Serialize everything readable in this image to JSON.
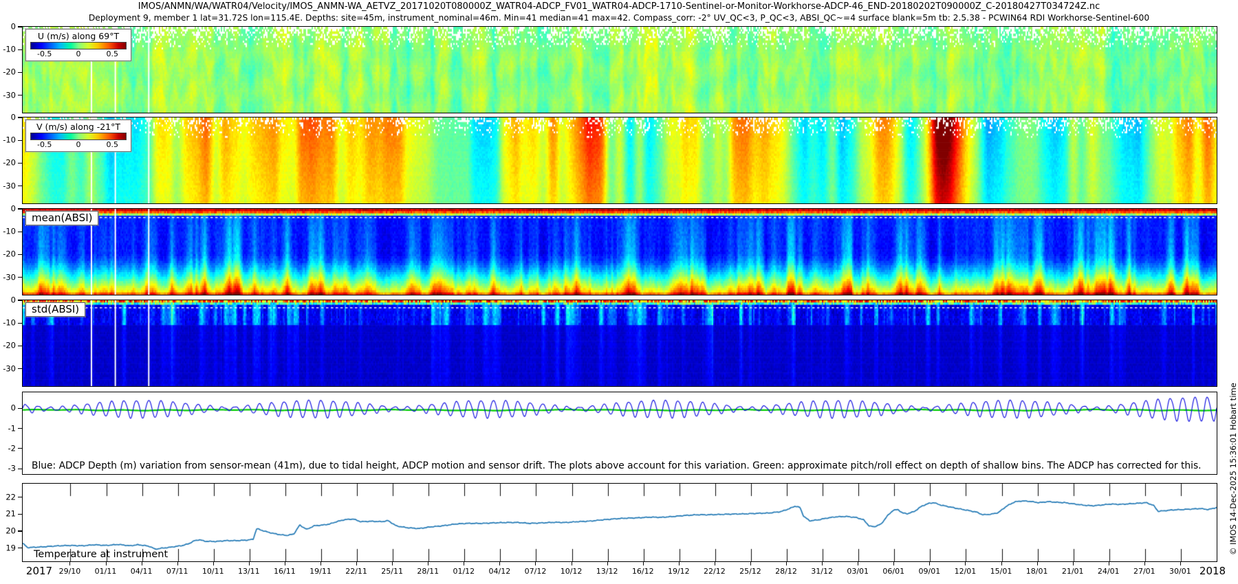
{
  "meta": {
    "title_line1": "IMOS/ANMN/WA/WATR04/Velocity/IMOS_ANMN-WA_AETVZ_20171020T080000Z_WATR04-ADCP_FV01_WATR04-ADCP-1710-Sentinel-or-Monitor-Workhorse-ADCP-46_END-20180202T090000Z_C-20180427T034724Z.nc",
    "title_line2": "Deployment 9, member 1 lat=31.72S lon=115.4E. Depths: site=45m, instrument_nominal=46m. Min=41 median=41 max=42. Compass_corr: -2° UV_QC<3, P_QC<3, ABSI_QC~=4 surface blank=5m tb: 2.5.38 - PCWIN64 RDI Workhorse-Sentinel-600",
    "watermark": "© IMOS 14-Dec-2025 15:36:01 Hobart time"
  },
  "axes": {
    "heatmap": {
      "labels": [
        "0",
        "-10",
        "-20",
        "-30"
      ],
      "values": [
        0,
        -10,
        -20,
        -30
      ],
      "ylim": [
        0,
        -37
      ]
    },
    "depth": {
      "labels": [
        "0",
        "-1",
        "-2",
        "-3"
      ],
      "values": [
        0,
        -1,
        -2,
        -3
      ],
      "ylim": [
        0.8,
        -3.2
      ]
    },
    "temp": {
      "labels": [
        "22",
        "21",
        "20",
        "19"
      ],
      "values": [
        22,
        21,
        20,
        19
      ],
      "ylim": [
        22.8,
        18.3
      ]
    },
    "x": {
      "year_left": "2017",
      "year_right": "2018",
      "range_days": 100,
      "date_ticks": [
        {
          "label": "29/10",
          "day": 4
        },
        {
          "label": "01/11",
          "day": 7
        },
        {
          "label": "04/11",
          "day": 10
        },
        {
          "label": "07/11",
          "day": 13
        },
        {
          "label": "10/11",
          "day": 16
        },
        {
          "label": "13/11",
          "day": 19
        },
        {
          "label": "16/11",
          "day": 22
        },
        {
          "label": "19/11",
          "day": 25
        },
        {
          "label": "22/11",
          "day": 28
        },
        {
          "label": "25/11",
          "day": 31
        },
        {
          "label": "28/11",
          "day": 34
        },
        {
          "label": "01/12",
          "day": 37
        },
        {
          "label": "04/12",
          "day": 40
        },
        {
          "label": "07/12",
          "day": 43
        },
        {
          "label": "10/12",
          "day": 46
        },
        {
          "label": "13/12",
          "day": 49
        },
        {
          "label": "16/12",
          "day": 52
        },
        {
          "label": "19/12",
          "day": 55
        },
        {
          "label": "22/12",
          "day": 58
        },
        {
          "label": "25/12",
          "day": 61
        },
        {
          "label": "28/12",
          "day": 64
        },
        {
          "label": "31/12",
          "day": 67
        },
        {
          "label": "03/01",
          "day": 70
        },
        {
          "label": "06/01",
          "day": 73
        },
        {
          "label": "09/01",
          "day": 76
        },
        {
          "label": "12/01",
          "day": 79
        },
        {
          "label": "15/01",
          "day": 82
        },
        {
          "label": "18/01",
          "day": 85
        },
        {
          "label": "21/01",
          "day": 88
        },
        {
          "label": "24/01",
          "day": 91
        },
        {
          "label": "27/01",
          "day": 94
        },
        {
          "label": "30/01",
          "day": 97
        }
      ]
    }
  },
  "panels": {
    "u": {
      "legend": "U (m/s) along 69°T",
      "colorbar_ticks": [
        "-0.5",
        "0",
        "0.5"
      ],
      "clim": [
        -0.7,
        0.7
      ]
    },
    "v": {
      "legend": "V (m/s) along -21°T",
      "colorbar_ticks": [
        "-0.5",
        "0",
        "0.5"
      ],
      "clim": [
        -0.7,
        0.7
      ]
    },
    "mean_absi": {
      "label": "mean(ABSI)"
    },
    "std_absi": {
      "label": "std(ABSI)"
    },
    "depth": {
      "note": "Blue: ADCP Depth (m) variation from sensor-mean (41m), due to tidal height, ADCP motion and sensor drift. The plots above account for this variation. Green: approximate pitch/roll effect on depth of shallow bins. The ADCP has corrected for this."
    },
    "temp": {
      "label": "Temperature at instrument"
    }
  },
  "chart_data": [
    {
      "id": "u",
      "type": "heatmap",
      "title": "U (m/s) along 69°T",
      "colormap": "jet",
      "clim": [
        -0.7,
        0.7
      ],
      "colorbar_ticks": [
        -0.5,
        0,
        0.5
      ],
      "ylim_m": [
        0,
        -37
      ],
      "x_start_date": "2017-10-25",
      "x_end_date": "2018-02-02",
      "description": "Velocity component along 69°T vs depth and time; mostly 0 to 0.15 m/s (green) with fine vertical banding and white missing-data speckle in the upper ~10 m",
      "render": {
        "seed": 101,
        "gap_days": [
          5.7,
          7.7,
          10.5
        ]
      }
    },
    {
      "id": "v",
      "type": "heatmap",
      "title": "V (m/s) along -21°T",
      "colormap": "jet",
      "clim": [
        -0.7,
        0.7
      ],
      "colorbar_ticks": [
        -0.5,
        0,
        0.5
      ],
      "ylim_m": [
        0,
        -37
      ],
      "x_start_date": "2017-10-25",
      "x_end_date": "2018-02-02",
      "description": "Velocity component along -21°T; broad alternating bands from -0.3 (cyan) to +0.6 m/s (orange/red), strongest positive events near 19/12 and 09/01, negative events near 12/01 and 25/01",
      "render": {
        "seed": 202,
        "gap_days": [
          5.7,
          7.7,
          10.5
        ]
      }
    },
    {
      "id": "mean_absi",
      "type": "heatmap",
      "title": "mean(ABSI)",
      "colormap": "jet",
      "ylim_m": [
        0,
        -37
      ],
      "x_start_date": "2017-10-25",
      "x_end_date": "2018-02-02",
      "description": "Mean acoustic backscatter: dark red/orange in surface bins, low (dark blue) mid-water with cyan/green columnar events widening with depth, elevated yellow-orange values in near-bottom bins; white dotted quality line near -3.5 m",
      "render": {
        "seed": 303,
        "gap_days": [
          5.7,
          7.7,
          10.5
        ],
        "dotted_line_frac": 0.095
      }
    },
    {
      "id": "std_absi",
      "type": "heatmap",
      "title": "std(ABSI)",
      "colormap": "jet",
      "ylim_m": [
        0,
        -37
      ],
      "x_start_date": "2017-10-25",
      "x_end_date": "2018-02-02",
      "description": "Std of acoustic backscatter: orange/red speckle in top bins, cyan/green speckled streaks in upper ~10 m, nearly uniform dark blue below; white dotted quality line near -3 m",
      "render": {
        "seed": 404,
        "gap_days": [
          5.7,
          7.7,
          10.5
        ],
        "dotted_line_frac": 0.082
      }
    },
    {
      "id": "depth",
      "type": "line",
      "ylim": [
        0.8,
        -3.2
      ],
      "yticks": [
        0,
        -1,
        -2,
        -3
      ],
      "x_start_date": "2017-10-25",
      "x_end_date": "2018-02-02",
      "series": [
        {
          "name": "ADCP Depth (m) variation from sensor-mean (41m)",
          "color": "#0000dd",
          "description": "Diurnal tidal oscillation about 0, amplitude 0.1-0.55 m with spring-neap modulation, largest near end of record"
        },
        {
          "name": "Approximate pitch/roll effect on depth of shallow bins",
          "color": "#00cc00",
          "description": "Nearly flat line just below 0 (about -0.05 m)"
        }
      ],
      "note": "Blue: ADCP Depth (m) variation from sensor-mean (41m), due to tidal height, ADCP motion and sensor drift. The plots above account for this variation. Green: approximate pitch/roll effect on depth of shallow bins. The ADCP has corrected for this.",
      "render": {
        "tide_freq_cpd": 0.97,
        "spring_neap_days": 14.6,
        "amp_base": 0.07,
        "amp_mod": 0.36,
        "green_level": -0.05
      }
    },
    {
      "id": "temp",
      "type": "line",
      "name": "Temperature at instrument",
      "unit": "°C",
      "color": "#1f77b4",
      "ylim": [
        18.3,
        22.8
      ],
      "yticks": [
        19,
        20,
        21,
        22
      ],
      "x_start_date": "2017-10-25",
      "x_end_date": "2018-02-02",
      "points": [
        [
          0,
          19.35
        ],
        [
          0.4,
          19.1
        ],
        [
          1.5,
          19.13
        ],
        [
          3,
          19.2
        ],
        [
          4,
          19.22
        ],
        [
          5,
          19.2
        ],
        [
          6,
          19.26
        ],
        [
          7,
          19.22
        ],
        [
          8,
          19.28
        ],
        [
          9,
          19.2
        ],
        [
          9.6,
          19.26
        ],
        [
          10.2,
          19.22
        ],
        [
          10.7,
          19.15
        ],
        [
          11.1,
          19.0
        ],
        [
          11.6,
          19.06
        ],
        [
          12.2,
          19.1
        ],
        [
          12.8,
          19.16
        ],
        [
          13.4,
          19.22
        ],
        [
          13.9,
          19.32
        ],
        [
          14.4,
          19.5
        ],
        [
          14.8,
          19.55
        ],
        [
          15.3,
          19.46
        ],
        [
          16.2,
          19.45
        ],
        [
          17,
          19.5
        ],
        [
          18,
          19.5
        ],
        [
          18.8,
          19.53
        ],
        [
          19.3,
          19.58
        ],
        [
          19.6,
          20.2
        ],
        [
          20.1,
          20.08
        ],
        [
          20.6,
          19.98
        ],
        [
          21.4,
          19.86
        ],
        [
          22.1,
          19.8
        ],
        [
          22.7,
          19.88
        ],
        [
          23.2,
          20.4
        ],
        [
          23.8,
          20.15
        ],
        [
          24.4,
          20.36
        ],
        [
          25.1,
          20.4
        ],
        [
          25.7,
          20.46
        ],
        [
          26.3,
          20.6
        ],
        [
          27,
          20.72
        ],
        [
          27.7,
          20.75
        ],
        [
          28.3,
          20.6
        ],
        [
          29.2,
          20.62
        ],
        [
          30.1,
          20.6
        ],
        [
          30.6,
          20.66
        ],
        [
          31.3,
          20.35
        ],
        [
          32.2,
          20.25
        ],
        [
          33.2,
          20.2
        ],
        [
          34.2,
          20.3
        ],
        [
          35.2,
          20.36
        ],
        [
          36.2,
          20.46
        ],
        [
          37.2,
          20.5
        ],
        [
          38.5,
          20.5
        ],
        [
          39.5,
          20.53
        ],
        [
          40.5,
          20.55
        ],
        [
          41.5,
          20.55
        ],
        [
          42.5,
          20.5
        ],
        [
          43.5,
          20.53
        ],
        [
          44.5,
          20.56
        ],
        [
          45.5,
          20.55
        ],
        [
          46.5,
          20.6
        ],
        [
          47.5,
          20.63
        ],
        [
          48.5,
          20.7
        ],
        [
          49.5,
          20.76
        ],
        [
          50.5,
          20.8
        ],
        [
          51.5,
          20.82
        ],
        [
          52.5,
          20.86
        ],
        [
          53.5,
          20.85
        ],
        [
          54.5,
          20.9
        ],
        [
          55.5,
          20.96
        ],
        [
          56.5,
          21.0
        ],
        [
          57.5,
          21.0
        ],
        [
          58.5,
          21.02
        ],
        [
          59.5,
          21.04
        ],
        [
          60.5,
          21.05
        ],
        [
          61.5,
          21.08
        ],
        [
          62.5,
          21.1
        ],
        [
          63.5,
          21.18
        ],
        [
          64.2,
          21.35
        ],
        [
          64.7,
          21.5
        ],
        [
          65.1,
          21.42
        ],
        [
          65.4,
          20.92
        ],
        [
          65.9,
          20.65
        ],
        [
          66.6,
          20.7
        ],
        [
          67.3,
          20.8
        ],
        [
          68.1,
          20.88
        ],
        [
          69,
          20.9
        ],
        [
          69.8,
          20.84
        ],
        [
          70.4,
          20.72
        ],
        [
          70.9,
          20.35
        ],
        [
          71.3,
          20.3
        ],
        [
          71.9,
          20.46
        ],
        [
          72.4,
          20.92
        ],
        [
          72.9,
          21.26
        ],
        [
          73.3,
          21.3
        ],
        [
          73.7,
          21.1
        ],
        [
          74.1,
          21.06
        ],
        [
          74.7,
          21.2
        ],
        [
          75.3,
          21.5
        ],
        [
          75.9,
          21.66
        ],
        [
          76.3,
          21.7
        ],
        [
          76.9,
          21.56
        ],
        [
          77.6,
          21.46
        ],
        [
          78.3,
          21.36
        ],
        [
          79.1,
          21.26
        ],
        [
          79.9,
          21.15
        ],
        [
          80.4,
          21.0
        ],
        [
          81.1,
          21.03
        ],
        [
          81.7,
          21.12
        ],
        [
          82.4,
          21.5
        ],
        [
          83.1,
          21.75
        ],
        [
          83.7,
          21.8
        ],
        [
          84.3,
          21.78
        ],
        [
          85.1,
          21.7
        ],
        [
          85.9,
          21.76
        ],
        [
          86.6,
          21.72
        ],
        [
          87.3,
          21.7
        ],
        [
          88.1,
          21.62
        ],
        [
          88.9,
          21.55
        ],
        [
          89.6,
          21.52
        ],
        [
          90.3,
          21.56
        ],
        [
          91.1,
          21.62
        ],
        [
          91.9,
          21.6
        ],
        [
          92.6,
          21.63
        ],
        [
          93.3,
          21.66
        ],
        [
          94.1,
          21.7
        ],
        [
          94.7,
          21.55
        ],
        [
          95.1,
          21.2
        ],
        [
          95.6,
          21.23
        ],
        [
          96.3,
          21.28
        ],
        [
          97.1,
          21.3
        ],
        [
          97.9,
          21.33
        ],
        [
          98.6,
          21.36
        ],
        [
          99.3,
          21.3
        ],
        [
          100,
          21.42
        ]
      ]
    }
  ]
}
